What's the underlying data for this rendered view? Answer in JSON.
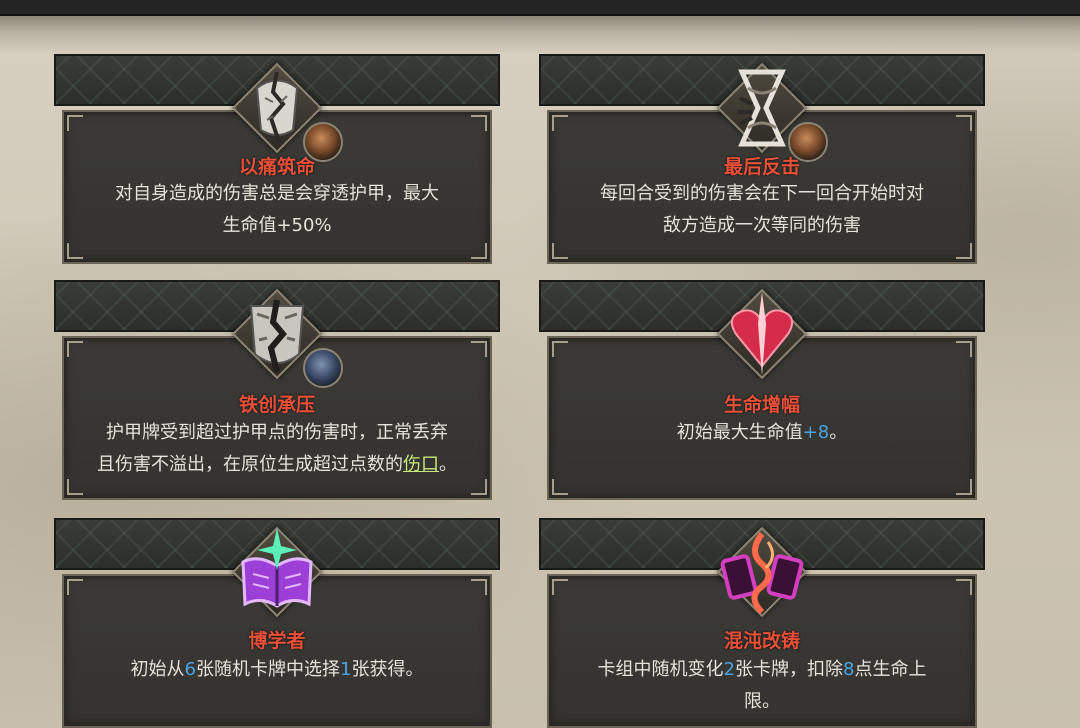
{
  "cards": [
    {
      "title": "以痛筑命",
      "desc_line1": "对自身造成的伤害总是会穿透护甲，最大",
      "desc_line2": "生命值+50%",
      "icon": "torn-armor-icon",
      "has_avatar": true
    },
    {
      "title": "最后反击",
      "desc_line1": "每回合受到的伤害会在下一回合开始时对",
      "desc_line2": "敌方造成一次等同的伤害",
      "icon": "hourglass-claw-icon",
      "has_avatar": true
    },
    {
      "title": "铁创承压",
      "desc_line1": "护甲牌受到超过护甲点的伤害时，正常丢弃",
      "desc_line2_pre": "且伤害不溢出，在原位生成超过点数的",
      "desc_line2_link": "伤口",
      "desc_line2_post": "。",
      "icon": "cracked-shield-icon",
      "has_avatar": true
    },
    {
      "title": "生命增幅",
      "desc_pre": "初始最大生命值",
      "desc_value": "+8",
      "desc_post": "。",
      "icon": "heart-icon",
      "has_avatar": false
    },
    {
      "title": "博学者",
      "desc_pre": "初始从",
      "desc_v1": "6",
      "desc_mid": "张随机卡牌中选择",
      "desc_v2": "1",
      "desc_post": "张获得。",
      "icon": "spellbook-icon",
      "has_avatar": false
    },
    {
      "title": "混沌改铸",
      "desc_pre": "卡组中随机变化",
      "desc_v1": "2",
      "desc_mid": "张卡牌，扣除",
      "desc_v2": "8",
      "desc_post": "点生命上",
      "desc_line2": "限。",
      "icon": "chaos-cards-icon",
      "has_avatar": false
    }
  ],
  "colors": {
    "title": "#e8503a",
    "highlight_number": "#4aa3e3",
    "keyword_link": "#c6e87a",
    "text": "#e6e2da"
  }
}
